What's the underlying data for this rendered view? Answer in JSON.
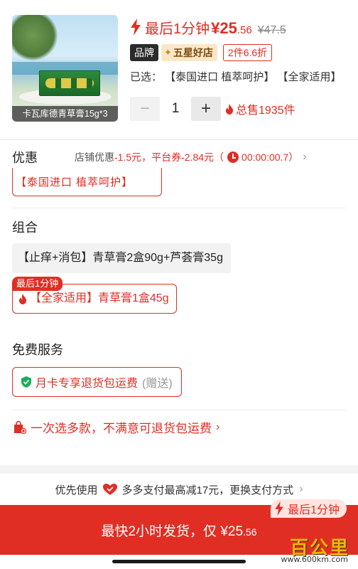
{
  "product": {
    "image_caption": "卡瓦库德青草膏15g*3",
    "flash_text": "最后1分钟",
    "price_int": "¥25",
    "price_dec": ".56",
    "original_price": "¥47.5",
    "badges": {
      "brand": "品牌",
      "star_store": "五星好店",
      "discount": "2件6.6折"
    },
    "selected": "已选：  【泰国进口  植萃呵护】  【全家适用】",
    "quantity": "1",
    "qty_minus": "−",
    "qty_plus": "+",
    "sold_total": "总售1935件"
  },
  "discount": {
    "label": "优惠",
    "store_prefix": "店铺优惠",
    "store_value": "-1.5元，",
    "platform_prefix": "平台券",
    "platform_value": "-2.84元（",
    "countdown": "00:00:00.7）"
  },
  "spec_peek": "【泰国进口  植萃呵护】",
  "combo": {
    "title": "组合",
    "option_1": "【止痒+消包】青草膏2盒90g+芦荟膏35g",
    "flash_tag": "最后1分钟",
    "option_2": "【全家适用】青草膏1盒45g"
  },
  "service": {
    "title": "免费服务",
    "chip_text": "月卡专享退货包运费",
    "chip_gift": "(赠送)"
  },
  "return_policy": "一次选多款，不满意可退货包运费",
  "payment": {
    "prefix": "优先使用",
    "text": "多多支付最高减17元，更换支付方式"
  },
  "cta": {
    "flash": "最后1分钟",
    "text": "最快2小时发货，仅 ¥25",
    "dec": ".56"
  },
  "watermark": {
    "title": "百公里",
    "url": "www.600km.com"
  },
  "colors": {
    "accent": "#e02e24",
    "gold": "#c9861d"
  }
}
